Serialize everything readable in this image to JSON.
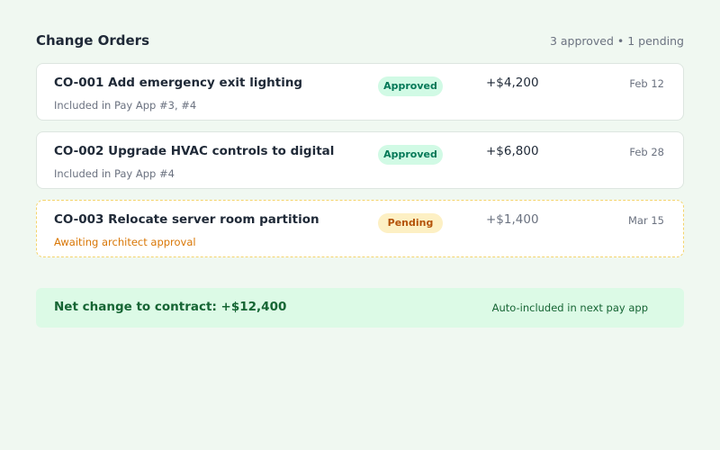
{
  "header": {
    "title": "Change Orders",
    "summary": "3 approved • 1 pending"
  },
  "orders": [
    {
      "title": "CO-001 Add emergency exit lighting",
      "subtitle": "Included in Pay App #3, #4",
      "status": "Approved",
      "amount": "+$4,200",
      "date": "Feb 12"
    },
    {
      "title": "CO-002 Upgrade HVAC controls to digital",
      "subtitle": "Included in Pay App #4",
      "status": "Approved",
      "amount": "+$6,800",
      "date": "Feb 28"
    },
    {
      "title": "CO-003 Relocate server room partition",
      "subtitle": "Awaiting architect approval",
      "status": "Pending",
      "amount": "+$1,400",
      "date": "Mar 15"
    }
  ],
  "footer": {
    "net_change": "Net change to contract: +$12,400",
    "note": "Auto-included in next pay app"
  },
  "colors": {
    "background": "#f0f8f1",
    "approved_badge_bg": "#d1fae5",
    "approved_badge_text": "#047857",
    "pending_badge_bg": "#fdf0c4",
    "pending_badge_text": "#b45309",
    "pending_border": "#f4d46c",
    "footer_bg": "#dcfae6",
    "footer_text": "#166534"
  }
}
